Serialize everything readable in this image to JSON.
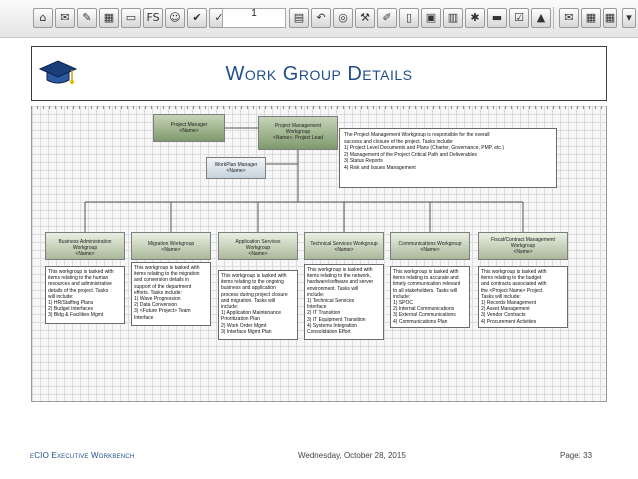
{
  "toolbar": {
    "page_field": "1",
    "buttons": [
      {
        "name": "home-icon",
        "glyph": "⌂"
      },
      {
        "name": "mail-icon",
        "glyph": "✉"
      },
      {
        "name": "pen-icon",
        "glyph": "✎"
      },
      {
        "name": "print-icon",
        "glyph": "▦"
      },
      {
        "name": "folder-icon",
        "glyph": "▭"
      },
      {
        "name": "fs-icon",
        "glyph": "FS"
      },
      {
        "name": "smiley-icon",
        "glyph": "☺"
      },
      {
        "name": "check-icon",
        "glyph": "✔"
      },
      {
        "name": "check-mark-icon",
        "glyph": "✓"
      },
      {
        "name": "document-icon",
        "glyph": "▤"
      },
      {
        "name": "undo-icon",
        "glyph": "↶"
      },
      {
        "name": "binoculars-icon",
        "glyph": "◎"
      },
      {
        "name": "wrench-icon",
        "glyph": "⚒"
      },
      {
        "name": "edit-icon",
        "glyph": "✐"
      },
      {
        "name": "page-icon",
        "glyph": "▯"
      },
      {
        "name": "image-icon",
        "glyph": "▣"
      },
      {
        "name": "gallery-icon",
        "glyph": "▥"
      },
      {
        "name": "tools-icon",
        "glyph": "✱"
      },
      {
        "name": "note-icon",
        "glyph": "▬"
      },
      {
        "name": "checklist-icon",
        "glyph": "☑"
      },
      {
        "name": "lock-icon",
        "glyph": "▲"
      },
      {
        "name": "envelope-icon",
        "glyph": "✉"
      },
      {
        "name": "calendar-icon",
        "glyph": "▦"
      },
      {
        "name": "spreadsheet-icon",
        "glyph": "▦"
      },
      {
        "name": "dropdown-icon",
        "glyph": "▾"
      },
      {
        "name": "view-icon",
        "glyph": "▣"
      },
      {
        "name": "menu-dropdown-icon",
        "glyph": "▾"
      }
    ]
  },
  "title": "Work Group Details",
  "title_icon": "graduation-cap-icon",
  "diagram": {
    "project_manager": {
      "line1": "Project Manager",
      "line2": "<Name>"
    },
    "pm_workgroup": {
      "line1": "Project Management",
      "line2": "Workgroup",
      "line3": "<Name>, Project Lead"
    },
    "pm_description": {
      "lines": [
        "The Project Management Workgroup is responsible for the overall",
        "success and closure of the project.  Tasks include:",
        "1)  Project Level Documents and Plans (Charter, Governance, PMP, etc.)",
        "2)  Management of the Project Critical Path  and Deliverables",
        "3)  Status Reports",
        "4)  Risk and Issues Management"
      ]
    },
    "workplan_manager": {
      "line1": "WorkPlan Manager",
      "line2": "<Name>"
    },
    "workgroups": [
      {
        "line1": "Business Administration",
        "line2": "Workgroup",
        "line3": "<Name>",
        "desc": [
          "This workgroup is tasked with",
          "items relating to the human",
          "resources and administrative",
          "details of the project.  Tasks",
          "will include:",
          "  1)  HR/Staffing Plans",
          "  2)  Budget Interfaces",
          "  3)  Bldg & Facilities Mgmt"
        ]
      },
      {
        "line1": "Migration Workgroup",
        "line2": "<Name>",
        "line3": "",
        "desc": [
          "This workgroup is tasked with",
          "items relating to the migration",
          "and conversion  details in",
          "support of the department",
          "efforts.  Tasks include:",
          "  1)  Wave Progression",
          "  2)  Data Conversion",
          "  3)  <Future Project> Team",
          "Interface"
        ]
      },
      {
        "line1": "Application Services",
        "line2": "Workgroup",
        "line3": "<Name>",
        "desc": [
          "This workgroup is tasked with",
          "items relating to the ongoing",
          "business and application",
          "process during project closure",
          "and migration.  Tasks will",
          "include:",
          "  1)  Application Maintenance",
          "      Prioritization Plan",
          "  2)  Work Order Mgmt",
          "  3)  Interface Mgmt Plan"
        ]
      },
      {
        "line1": "Technical Services Workgroup",
        "line2": "<Name>",
        "line3": "",
        "desc": [
          "This workgroup is tasked with",
          "items relating to the network,",
          "hardware/software and server",
          "environment.  Tasks will",
          "include:",
          "  1) Technical Services",
          "Interface",
          "  2)  IT Transition",
          "  3)  IT Equipment Transition",
          "  4)  Systems Integration",
          "Consolidation Effort"
        ]
      },
      {
        "line1": "Communications Workgroup",
        "line2": "<Name>",
        "line3": "",
        "desc": [
          "This workgroup is tasked with",
          "items relating to accurate and",
          "timely communication relevant",
          "to all stakeholders.  Tasks will",
          "include:",
          "  1)  SPOC",
          "  2)  Internal Communications",
          "  3)  External Communications",
          "  4)  Communications Plan"
        ]
      },
      {
        "line1": "Fiscal/Contract Management",
        "line2": "Workgroup",
        "line3": "<Name>",
        "desc": [
          "This workgroup is tasked with",
          "items relating to the budget",
          "and contracts associated with",
          "the <Project Name> Project.",
          "Tasks will include:",
          "  1)  Records Management",
          "  2)  Asset Management",
          "  3)  Vendor Contracts",
          "  4)  Procurement Activities"
        ]
      }
    ]
  },
  "footer": {
    "left": "eCIO Executive Workbench",
    "date": "Wednesday, October 28, 2015",
    "page": "Page: 33"
  }
}
